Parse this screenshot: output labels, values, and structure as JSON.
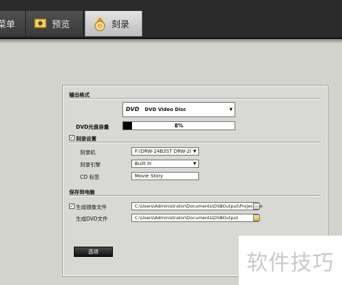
{
  "tabs": [
    {
      "label": "菜单",
      "icon": "menu-icon"
    },
    {
      "label": "预览",
      "icon": "preview-icon"
    },
    {
      "label": "刻录",
      "icon": "disc-burn-icon"
    }
  ],
  "active_tab": "刻录",
  "output_format": {
    "section_label": "输出格式",
    "format_value": "DVD Video Disc",
    "format_logo": "DVD"
  },
  "capacity": {
    "label": "DVD光盘容量",
    "percent_text": "8%",
    "fraction": 0.08
  },
  "burn_settings": {
    "checkbox_label": "刻录设置",
    "checked": true,
    "burner_label": "刻录机",
    "burner_value": "F:(DRW-24B3ST    DRW-2(",
    "engine_label": "刻录引擎",
    "engine_value": "Built In",
    "cd_label_label": "CD 标签",
    "cd_label_value": "Movie Story"
  },
  "save_to_pc": {
    "section_label": "保存到电脑",
    "iso_checkbox_label": "生成镜像文件",
    "iso_checked": true,
    "iso_path": "C:\\Users\\Administrator\\Documents\\DSBOutput\\Project.iso",
    "dvd_files_label": "生成DVD文件",
    "dvd_path": "C:\\Users\\Administrator\\Documents\\DSBOutput"
  },
  "options_button": "选项",
  "watermark": "软件技巧"
}
